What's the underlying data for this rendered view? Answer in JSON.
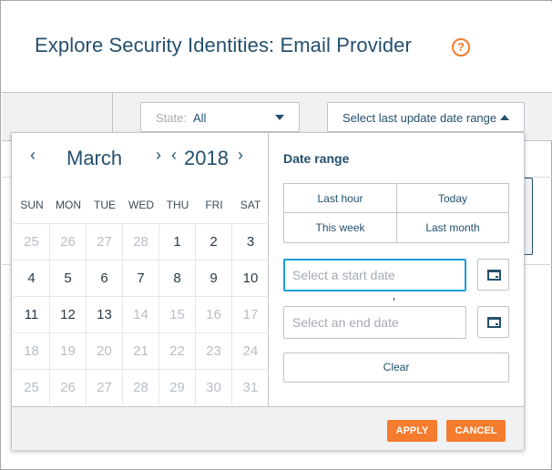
{
  "header": {
    "title": "Explore Security Identities: Email Provider",
    "help_icon": "?"
  },
  "toolbar": {
    "state_label": "State:",
    "state_value": "All",
    "date_range_button": "Select last update date range"
  },
  "calendar": {
    "prev_month": "‹",
    "month": "March",
    "next_month": "›",
    "prev_year": "‹",
    "year": "2018",
    "next_year": "›",
    "weekdays": [
      "SUN",
      "MON",
      "TUE",
      "WED",
      "THU",
      "FRI",
      "SAT"
    ],
    "weeks": [
      [
        {
          "d": "25",
          "m": true
        },
        {
          "d": "26",
          "m": true
        },
        {
          "d": "27",
          "m": true
        },
        {
          "d": "28",
          "m": true
        },
        {
          "d": "1",
          "m": false
        },
        {
          "d": "2",
          "m": false
        },
        {
          "d": "3",
          "m": false
        }
      ],
      [
        {
          "d": "4",
          "m": false
        },
        {
          "d": "5",
          "m": false
        },
        {
          "d": "6",
          "m": false
        },
        {
          "d": "7",
          "m": false
        },
        {
          "d": "8",
          "m": false
        },
        {
          "d": "9",
          "m": false
        },
        {
          "d": "10",
          "m": false
        }
      ],
      [
        {
          "d": "11",
          "m": false
        },
        {
          "d": "12",
          "m": false
        },
        {
          "d": "13",
          "m": false
        },
        {
          "d": "14",
          "m": true
        },
        {
          "d": "15",
          "m": true
        },
        {
          "d": "16",
          "m": true
        },
        {
          "d": "17",
          "m": true
        }
      ],
      [
        {
          "d": "18",
          "m": true
        },
        {
          "d": "19",
          "m": true
        },
        {
          "d": "20",
          "m": true
        },
        {
          "d": "21",
          "m": true
        },
        {
          "d": "22",
          "m": true
        },
        {
          "d": "23",
          "m": true
        },
        {
          "d": "24",
          "m": true
        }
      ],
      [
        {
          "d": "25",
          "m": true
        },
        {
          "d": "26",
          "m": true
        },
        {
          "d": "27",
          "m": true
        },
        {
          "d": "28",
          "m": true
        },
        {
          "d": "29",
          "m": true
        },
        {
          "d": "30",
          "m": true
        },
        {
          "d": "31",
          "m": true
        }
      ]
    ]
  },
  "date_range": {
    "title": "Date range",
    "presets": [
      "Last hour",
      "Today",
      "This week",
      "Last month"
    ],
    "start_placeholder": "Select a start date",
    "start_value": "",
    "end_placeholder": "Select an end date",
    "end_value": "",
    "clear_label": "Clear",
    "icons": {
      "calendar": "calendar-icon"
    }
  },
  "footer": {
    "apply_label": "APPLY",
    "cancel_label": "CANCEL"
  },
  "colors": {
    "accent": "#f47c2e",
    "primary_text": "#24506e",
    "focus": "#1a9fd8",
    "panel_bg": "#f0f1f3"
  }
}
